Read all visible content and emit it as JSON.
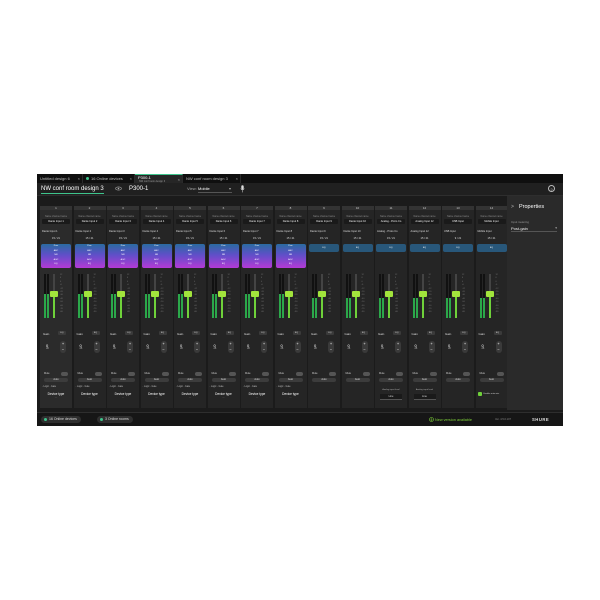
{
  "tabs": [
    {
      "label": "Untitled design 6",
      "close": "×",
      "active": false,
      "dot": false
    },
    {
      "label": "16 Online devices",
      "close": "×",
      "active": false,
      "dot": true
    },
    {
      "label": "P300-1",
      "sub": "NW conf room design 3",
      "close": "×",
      "active": true,
      "dot": false
    },
    {
      "label": "NW conf room design 3",
      "close": "×",
      "active": false,
      "dot": false
    }
  ],
  "header": {
    "design_title": "NW conf room design 3",
    "device_name": "P300-1",
    "view_label": "View:",
    "view_value": "Mobile",
    "help": "?"
  },
  "channel_common": {
    "name_label": "Name channel name",
    "gain_label": "Gain",
    "gain_box": "EQ",
    "gain_value": "0",
    "gain_unit": "dB",
    "plus": "+",
    "minus": "−",
    "mute_label": "Mute",
    "solo_label": "Auto",
    "logic_a": "Logic",
    "logic_b": "Gate",
    "device_type": "Device type",
    "device_type_sub": "—",
    "scale": [
      "12",
      "6",
      "0",
      "-6",
      "-12",
      "-20",
      "-30",
      "-40",
      "-50",
      "-60",
      "-70",
      "-80"
    ],
    "proc_labels": [
      "Proc",
      "AEC",
      "NR",
      "AGC",
      "EQ"
    ],
    "proc_plain": "EQ",
    "analog_level_label": "Analog input level",
    "analog_level_value": "Line",
    "dsp_label": "Enable auto mix"
  },
  "channels": [
    {
      "num": "1",
      "name": "Dante Input 1",
      "input": "Dante Input 1",
      "route": "15 / 21",
      "proc": "full",
      "footer": "device",
      "meter": 0.55,
      "fader": 0.62
    },
    {
      "num": "2",
      "name": "Dante Input 2",
      "input": "Dante Input 2",
      "route": "15 / 21",
      "proc": "full",
      "footer": "device",
      "meter": 0.55,
      "fader": 0.62
    },
    {
      "num": "3",
      "name": "Dante Input 3",
      "input": "Dante Input 3",
      "route": "15 / 21",
      "proc": "full",
      "footer": "device",
      "meter": 0.55,
      "fader": 0.62
    },
    {
      "num": "4",
      "name": "Dante Input 4",
      "input": "Dante Input 4",
      "route": "15 / 21",
      "proc": "full",
      "footer": "device",
      "meter": 0.55,
      "fader": 0.62
    },
    {
      "num": "5",
      "name": "Dante Input 5",
      "input": "Dante Input 5",
      "route": "15 / 21",
      "proc": "full",
      "footer": "device",
      "meter": 0.55,
      "fader": 0.62
    },
    {
      "num": "6",
      "name": "Dante Input 6",
      "input": "Dante Input 6",
      "route": "15 / 21",
      "proc": "full",
      "footer": "device",
      "meter": 0.55,
      "fader": 0.62
    },
    {
      "num": "7",
      "name": "Dante Input 7",
      "input": "Dante Input 7",
      "route": "15 / 21",
      "proc": "full",
      "footer": "device",
      "meter": 0.55,
      "fader": 0.62
    },
    {
      "num": "8",
      "name": "Dante Input 8",
      "input": "Dante Input 8",
      "route": "15 / 21",
      "proc": "full",
      "footer": "device",
      "meter": 0.55,
      "fader": 0.62
    },
    {
      "num": "9",
      "name": "Dante Input 9",
      "input": "Dante Input 9",
      "route": "15 / 21",
      "proc": "plain",
      "footer": "none",
      "meter": 0.45,
      "fader": 0.62
    },
    {
      "num": "10",
      "name": "Dante Input 10",
      "input": "Dante Input 10",
      "route": "15 / 21",
      "proc": "plain",
      "footer": "none",
      "meter": 0.45,
      "fader": 0.62
    },
    {
      "num": "11",
      "name": "Analog - Proto Co",
      "input": "Analog - Proto Co",
      "route": "15 / 21",
      "proc": "plain",
      "footer": "analog",
      "meter": 0.45,
      "fader": 0.62
    },
    {
      "num": "12",
      "name": "Analog Input 12",
      "input": "Analog Input 12",
      "route": "15 / 21",
      "proc": "plain",
      "footer": "analog",
      "meter": 0.45,
      "fader": 0.62
    },
    {
      "num": "13",
      "name": "USB Input",
      "input": "USB Input",
      "route": "9 / 21",
      "proc": "plain",
      "footer": "none",
      "meter": 0.45,
      "fader": 0.62
    },
    {
      "num": "14",
      "name": "Mobile Input",
      "input": "Mobile Input",
      "route": "15 / 21",
      "proc": "plain",
      "footer": "dsp",
      "meter": 0.45,
      "fader": 0.62
    }
  ],
  "properties": {
    "title": "Properties",
    "chev": ">",
    "field_label": "Input metering",
    "field_value": "Post-gain"
  },
  "footer": {
    "online_devices": "16 Online devices",
    "online_rooms": "3 Online rooms",
    "update": "New version available",
    "version": "Ver. 4.5.0.107",
    "brand": "SHURE"
  },
  "colors": {
    "accent": "#3ec48c",
    "fader": "#a2e43c",
    "meter": "#2ba84a"
  }
}
